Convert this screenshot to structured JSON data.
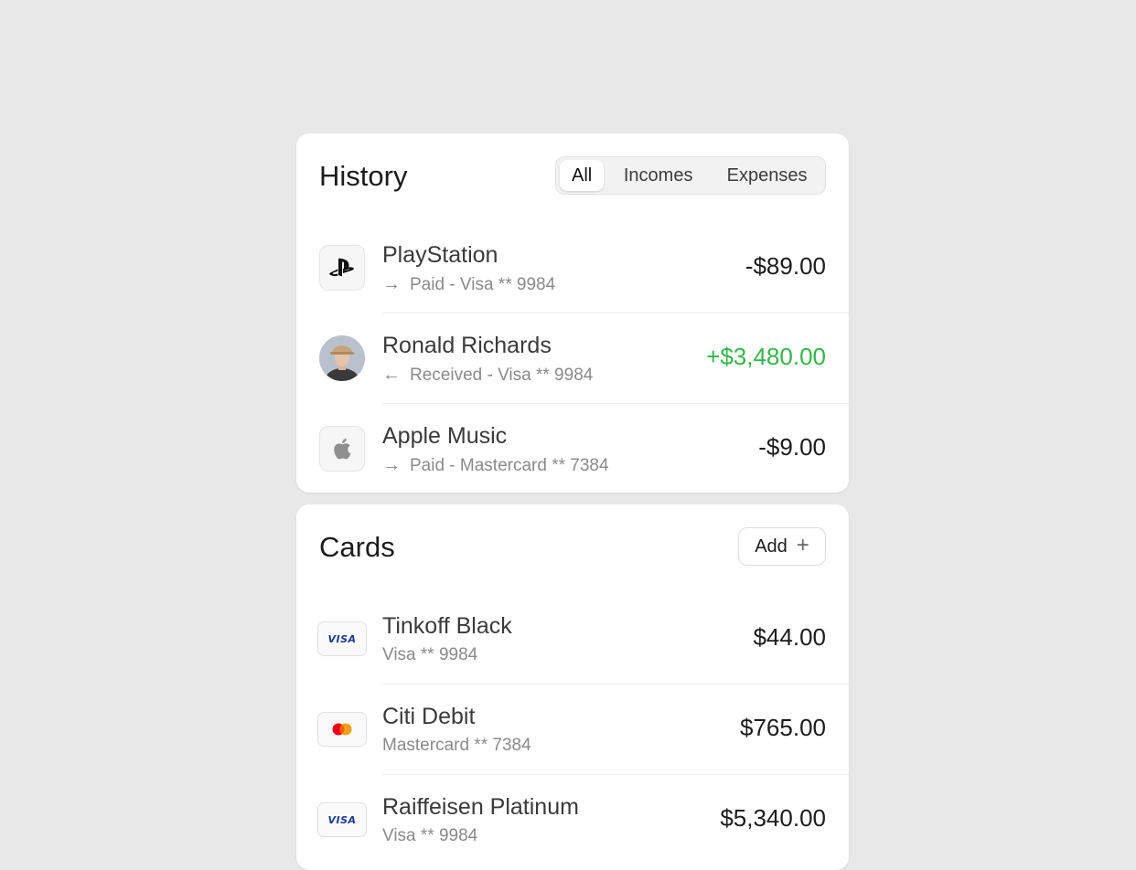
{
  "history": {
    "title": "History",
    "tabs": [
      {
        "label": "All",
        "active": true
      },
      {
        "label": "Incomes",
        "active": false
      },
      {
        "label": "Expenses",
        "active": false
      }
    ],
    "items": [
      {
        "name": "PlayStation",
        "direction_icon": "arrow-right-icon",
        "detail": "Paid - Visa ** 9984",
        "amount": "-$89.00",
        "icon": "playstation-icon"
      },
      {
        "name": "Ronald Richards",
        "direction_icon": "arrow-left-icon",
        "detail": "Received - Visa ** 9984",
        "amount": "+$3,480.00",
        "icon": "avatar"
      },
      {
        "name": "Apple Music",
        "direction_icon": "arrow-right-icon",
        "detail": "Paid - Mastercard ** 7384",
        "amount": "-$9.00",
        "icon": "apple-icon"
      }
    ]
  },
  "cards": {
    "title": "Cards",
    "add_label": "Add",
    "items": [
      {
        "name": "Tinkoff Black",
        "detail": "Visa ** 9984",
        "balance": "$44.00",
        "brand": "VISA"
      },
      {
        "name": "Citi Debit",
        "detail": "Mastercard ** 7384",
        "balance": "$765.00",
        "brand": "mastercard-icon"
      },
      {
        "name": "Raiffeisen Platinum",
        "detail": "Visa ** 9984",
        "balance": "$5,340.00",
        "brand": "VISA"
      }
    ]
  },
  "colors": {
    "background": "#e8e8e8",
    "income": "#33b54a",
    "text_primary": "#1c1c1c",
    "text_secondary": "#8a8a8a"
  }
}
